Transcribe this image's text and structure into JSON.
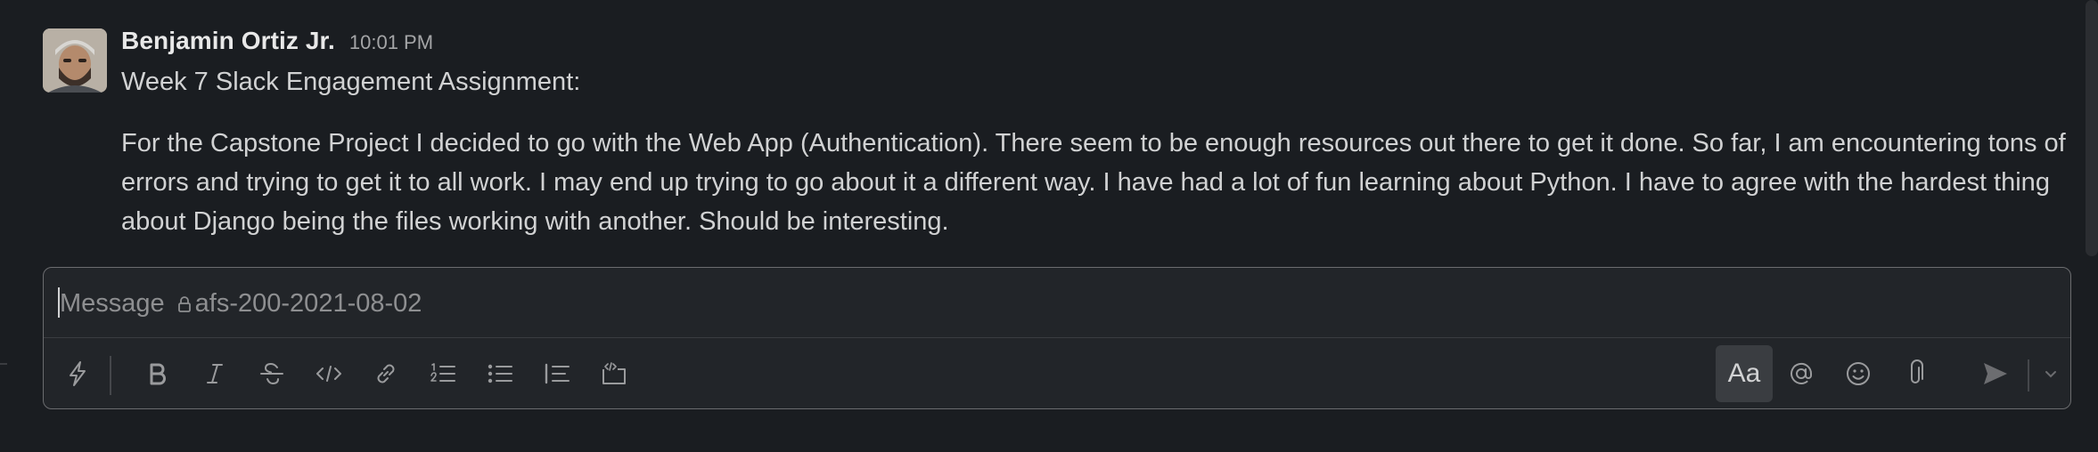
{
  "message": {
    "author": "Benjamin Ortiz Jr.",
    "timestamp": "10:01 PM",
    "line1": "Week 7 Slack Engagement Assignment:",
    "paragraph": "For the Capstone Project I decided to go with the Web App (Authentication). There seem to be enough resources out there to get it done. So far, I am encountering tons of errors and trying to get it to all work. I may end up trying to go about it a different way. I have had a lot of fun learning about Python. I have to agree with the hardest thing about Django being the files working with another. Should be interesting.",
    "avatar_icon": "user-avatar"
  },
  "composer": {
    "placeholder": "Message",
    "channel": "afs-200-2021-08-02",
    "channel_icon": "lock-icon",
    "format_toggle_label": "Aa",
    "toolbar_icons": [
      "shortcuts-lightning-icon",
      "bold-icon",
      "italic-icon",
      "strikethrough-icon",
      "code-icon",
      "link-icon",
      "ordered-list-icon",
      "bulleted-list-icon",
      "blockquote-icon",
      "code-block-icon",
      "mention-icon",
      "emoji-icon",
      "attachment-icon",
      "send-icon",
      "send-options-chevron-icon"
    ]
  },
  "colors": {
    "background": "#1a1d21",
    "composer_background": "#222529",
    "text": "#d1d2d3",
    "muted": "#9a9b9d"
  }
}
